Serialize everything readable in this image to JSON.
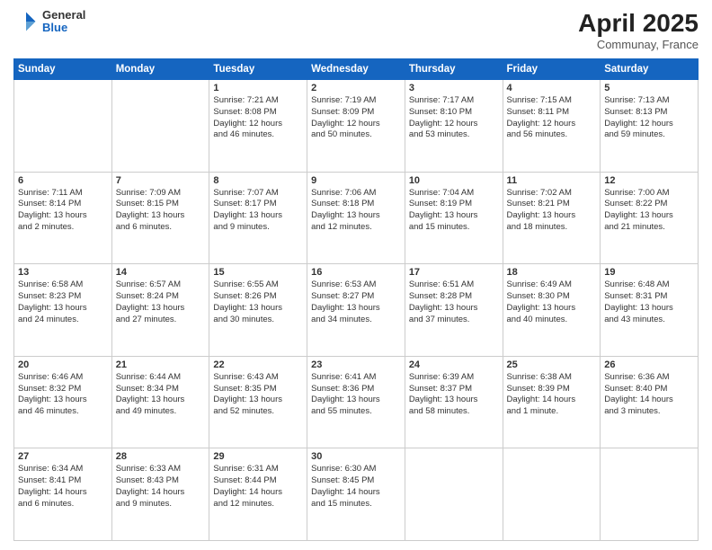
{
  "header": {
    "logo_general": "General",
    "logo_blue": "Blue",
    "title": "April 2025",
    "subtitle": "Communay, France"
  },
  "days_of_week": [
    "Sunday",
    "Monday",
    "Tuesday",
    "Wednesday",
    "Thursday",
    "Friday",
    "Saturday"
  ],
  "weeks": [
    [
      {
        "day": "",
        "content": ""
      },
      {
        "day": "",
        "content": ""
      },
      {
        "day": "1",
        "content": "Sunrise: 7:21 AM\nSunset: 8:08 PM\nDaylight: 12 hours\nand 46 minutes."
      },
      {
        "day": "2",
        "content": "Sunrise: 7:19 AM\nSunset: 8:09 PM\nDaylight: 12 hours\nand 50 minutes."
      },
      {
        "day": "3",
        "content": "Sunrise: 7:17 AM\nSunset: 8:10 PM\nDaylight: 12 hours\nand 53 minutes."
      },
      {
        "day": "4",
        "content": "Sunrise: 7:15 AM\nSunset: 8:11 PM\nDaylight: 12 hours\nand 56 minutes."
      },
      {
        "day": "5",
        "content": "Sunrise: 7:13 AM\nSunset: 8:13 PM\nDaylight: 12 hours\nand 59 minutes."
      }
    ],
    [
      {
        "day": "6",
        "content": "Sunrise: 7:11 AM\nSunset: 8:14 PM\nDaylight: 13 hours\nand 2 minutes."
      },
      {
        "day": "7",
        "content": "Sunrise: 7:09 AM\nSunset: 8:15 PM\nDaylight: 13 hours\nand 6 minutes."
      },
      {
        "day": "8",
        "content": "Sunrise: 7:07 AM\nSunset: 8:17 PM\nDaylight: 13 hours\nand 9 minutes."
      },
      {
        "day": "9",
        "content": "Sunrise: 7:06 AM\nSunset: 8:18 PM\nDaylight: 13 hours\nand 12 minutes."
      },
      {
        "day": "10",
        "content": "Sunrise: 7:04 AM\nSunset: 8:19 PM\nDaylight: 13 hours\nand 15 minutes."
      },
      {
        "day": "11",
        "content": "Sunrise: 7:02 AM\nSunset: 8:21 PM\nDaylight: 13 hours\nand 18 minutes."
      },
      {
        "day": "12",
        "content": "Sunrise: 7:00 AM\nSunset: 8:22 PM\nDaylight: 13 hours\nand 21 minutes."
      }
    ],
    [
      {
        "day": "13",
        "content": "Sunrise: 6:58 AM\nSunset: 8:23 PM\nDaylight: 13 hours\nand 24 minutes."
      },
      {
        "day": "14",
        "content": "Sunrise: 6:57 AM\nSunset: 8:24 PM\nDaylight: 13 hours\nand 27 minutes."
      },
      {
        "day": "15",
        "content": "Sunrise: 6:55 AM\nSunset: 8:26 PM\nDaylight: 13 hours\nand 30 minutes."
      },
      {
        "day": "16",
        "content": "Sunrise: 6:53 AM\nSunset: 8:27 PM\nDaylight: 13 hours\nand 34 minutes."
      },
      {
        "day": "17",
        "content": "Sunrise: 6:51 AM\nSunset: 8:28 PM\nDaylight: 13 hours\nand 37 minutes."
      },
      {
        "day": "18",
        "content": "Sunrise: 6:49 AM\nSunset: 8:30 PM\nDaylight: 13 hours\nand 40 minutes."
      },
      {
        "day": "19",
        "content": "Sunrise: 6:48 AM\nSunset: 8:31 PM\nDaylight: 13 hours\nand 43 minutes."
      }
    ],
    [
      {
        "day": "20",
        "content": "Sunrise: 6:46 AM\nSunset: 8:32 PM\nDaylight: 13 hours\nand 46 minutes."
      },
      {
        "day": "21",
        "content": "Sunrise: 6:44 AM\nSunset: 8:34 PM\nDaylight: 13 hours\nand 49 minutes."
      },
      {
        "day": "22",
        "content": "Sunrise: 6:43 AM\nSunset: 8:35 PM\nDaylight: 13 hours\nand 52 minutes."
      },
      {
        "day": "23",
        "content": "Sunrise: 6:41 AM\nSunset: 8:36 PM\nDaylight: 13 hours\nand 55 minutes."
      },
      {
        "day": "24",
        "content": "Sunrise: 6:39 AM\nSunset: 8:37 PM\nDaylight: 13 hours\nand 58 minutes."
      },
      {
        "day": "25",
        "content": "Sunrise: 6:38 AM\nSunset: 8:39 PM\nDaylight: 14 hours\nand 1 minute."
      },
      {
        "day": "26",
        "content": "Sunrise: 6:36 AM\nSunset: 8:40 PM\nDaylight: 14 hours\nand 3 minutes."
      }
    ],
    [
      {
        "day": "27",
        "content": "Sunrise: 6:34 AM\nSunset: 8:41 PM\nDaylight: 14 hours\nand 6 minutes."
      },
      {
        "day": "28",
        "content": "Sunrise: 6:33 AM\nSunset: 8:43 PM\nDaylight: 14 hours\nand 9 minutes."
      },
      {
        "day": "29",
        "content": "Sunrise: 6:31 AM\nSunset: 8:44 PM\nDaylight: 14 hours\nand 12 minutes."
      },
      {
        "day": "30",
        "content": "Sunrise: 6:30 AM\nSunset: 8:45 PM\nDaylight: 14 hours\nand 15 minutes."
      },
      {
        "day": "",
        "content": ""
      },
      {
        "day": "",
        "content": ""
      },
      {
        "day": "",
        "content": ""
      }
    ]
  ]
}
